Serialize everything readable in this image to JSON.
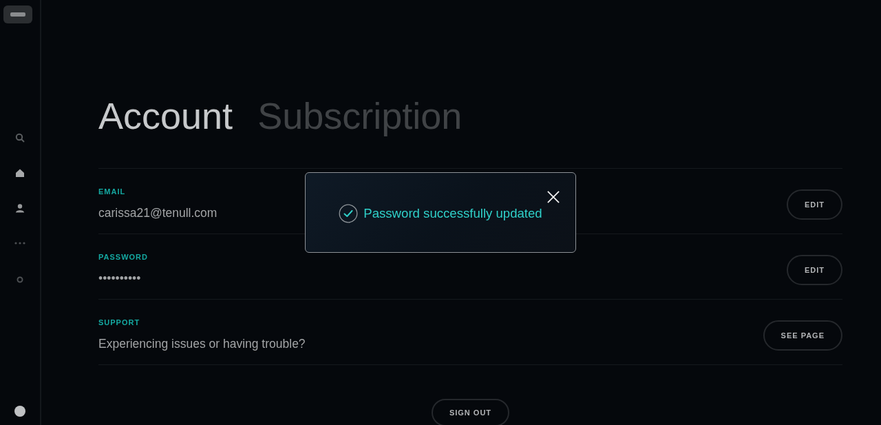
{
  "tabs": [
    {
      "label": "Account",
      "selected": true
    },
    {
      "label": "Subscription",
      "selected": false
    }
  ],
  "fields": [
    {
      "label": "EMAIL",
      "value": "carissa21@tenull.com",
      "action": "EDIT"
    },
    {
      "label": "PASSWORD",
      "value": "••••••••••",
      "action": "EDIT"
    },
    {
      "label": "SUPPORT",
      "value": "Experiencing issues or having trouble?",
      "action": "SEE PAGE"
    }
  ],
  "sign_out": "SIGN OUT",
  "toast": {
    "message": "Password successfully updated"
  }
}
